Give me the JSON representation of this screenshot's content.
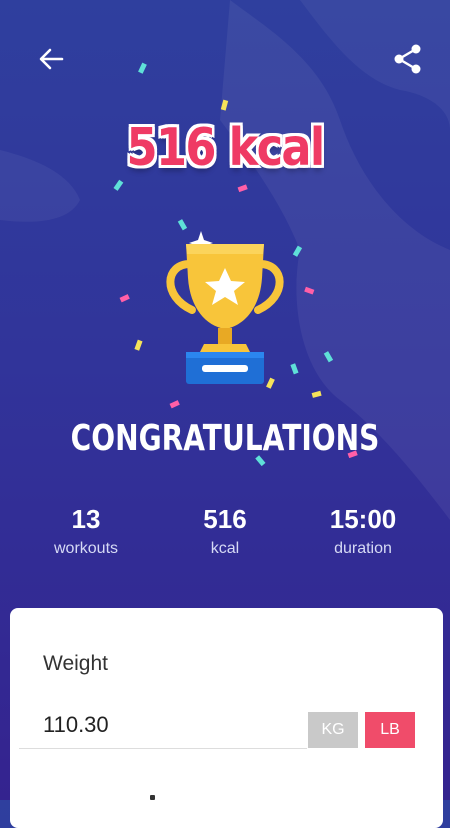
{
  "header": {
    "back_icon": "arrow-left-icon",
    "share_icon": "share-icon"
  },
  "result": {
    "kcal_title": "516 kcal",
    "congratulations": "CONGRATULATIONS",
    "trophy_icon": "trophy-icon"
  },
  "stats": [
    {
      "value": "13",
      "label": "workouts"
    },
    {
      "value": "516",
      "label": "kcal"
    },
    {
      "value": "15:00",
      "label": "duration"
    }
  ],
  "weight_card": {
    "title": "Weight",
    "value": "110.30",
    "units": [
      {
        "label": "KG",
        "selected": false
      },
      {
        "label": "LB",
        "selected": true
      }
    ]
  },
  "colors": {
    "accent": "#f04c6a",
    "background_top": "#2f3f9e",
    "background_bottom": "#34238f",
    "trophy": "#f8c53a",
    "unit_inactive": "#c9c9c9"
  }
}
